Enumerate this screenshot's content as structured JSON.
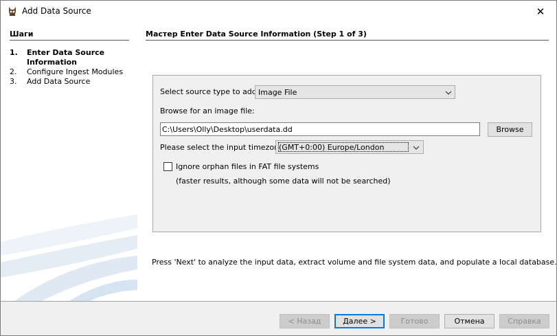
{
  "window": {
    "title": "Add Data Source",
    "close_glyph": "✕",
    "icon": "app-icon"
  },
  "steps": {
    "header": "Шаги",
    "items": [
      {
        "num": "1.",
        "label_line1": "Enter Data Source",
        "label_line2": "Information",
        "active": true
      },
      {
        "num": "2.",
        "label_line1": "Configure Ingest Modules",
        "active": false
      },
      {
        "num": "3.",
        "label_line1": "Add Data Source",
        "active": false
      }
    ]
  },
  "main": {
    "header": "Мастер Enter Data Source Information (Step 1 of 3)",
    "source_type_label": "Select source type to add:",
    "source_type_value": "Image File",
    "browse_label": "Browse for an image file:",
    "path_value": "C:\\Users\\Olly\\Desktop\\userdata.dd",
    "browse_button": "Browse",
    "timezone_label": "Please select the input timezone:",
    "timezone_value": "(GMT+0:00) Europe/London",
    "orphan_label": "Ignore orphan files in FAT file systems",
    "orphan_checked": false,
    "orphan_note": "(faster results, although some data will not be searched)",
    "next_note": "Press 'Next' to analyze the input data, extract volume and file system data, and populate a local database."
  },
  "buttons": {
    "back": "< Назад",
    "next": "Далее >",
    "finish": "Готово",
    "cancel": "Отмена",
    "help": "Справка"
  }
}
